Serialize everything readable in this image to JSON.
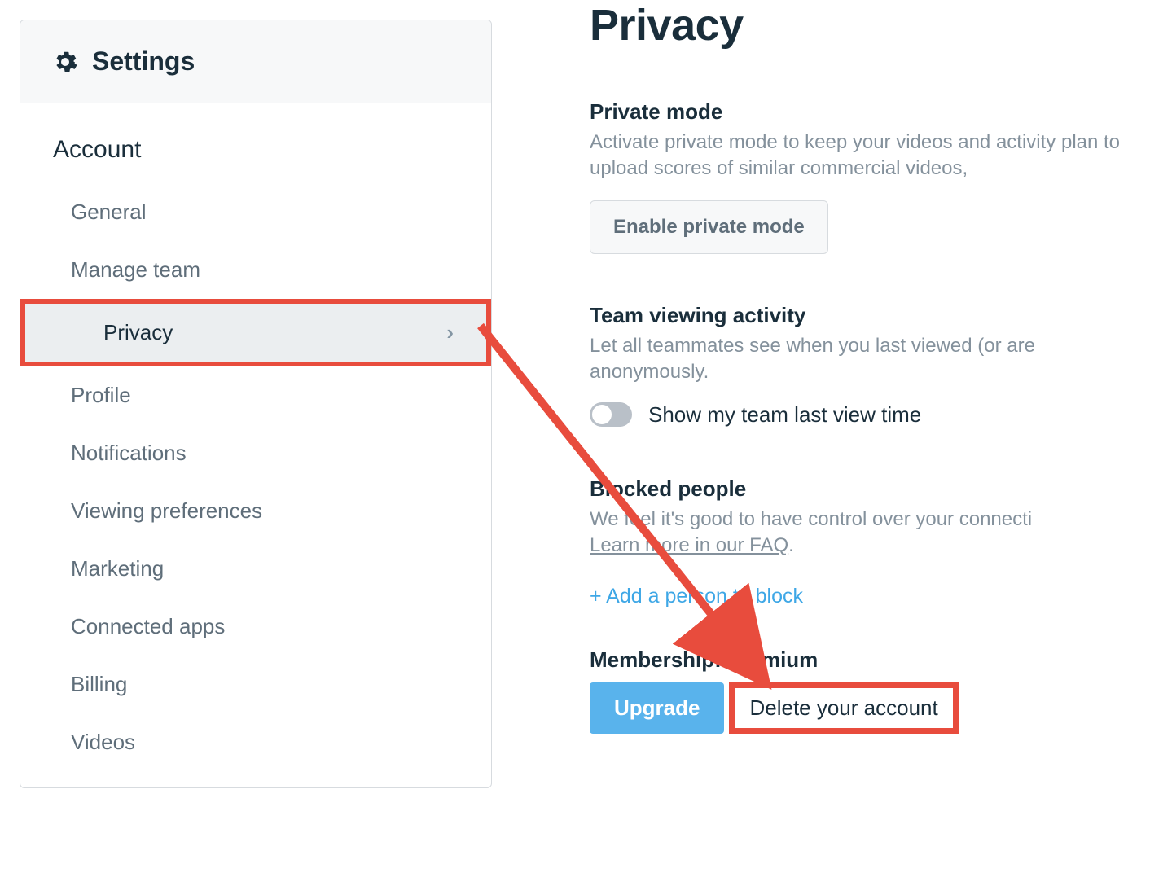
{
  "sidebar": {
    "title": "Settings",
    "section_heading": "Account",
    "items": [
      {
        "label": "General",
        "selected": false
      },
      {
        "label": "Manage team",
        "selected": false
      },
      {
        "label": "Privacy",
        "selected": true
      },
      {
        "label": "Profile",
        "selected": false
      },
      {
        "label": "Notifications",
        "selected": false
      },
      {
        "label": "Viewing preferences",
        "selected": false
      },
      {
        "label": "Marketing",
        "selected": false
      },
      {
        "label": "Connected apps",
        "selected": false
      },
      {
        "label": "Billing",
        "selected": false
      },
      {
        "label": "Videos",
        "selected": false
      }
    ]
  },
  "page": {
    "title": "Privacy",
    "private_mode": {
      "heading": "Private mode",
      "desc": "Activate private mode to keep your videos and activity plan to upload scores of similar commercial videos,",
      "button": "Enable private mode"
    },
    "team_viewing": {
      "heading": "Team viewing activity",
      "desc": "Let all teammates see when you last viewed (or are anonymously.",
      "toggle_label": "Show my team last view time"
    },
    "blocked": {
      "heading": "Blocked people",
      "desc": "We feel it's good to have control over your connecti",
      "faq": "Learn more in our FAQ",
      "add": "+ Add a person to block"
    },
    "membership": {
      "label_prefix": "Membership: ",
      "plan": "Premium",
      "upgrade": "Upgrade",
      "delete": "Delete your account"
    }
  }
}
